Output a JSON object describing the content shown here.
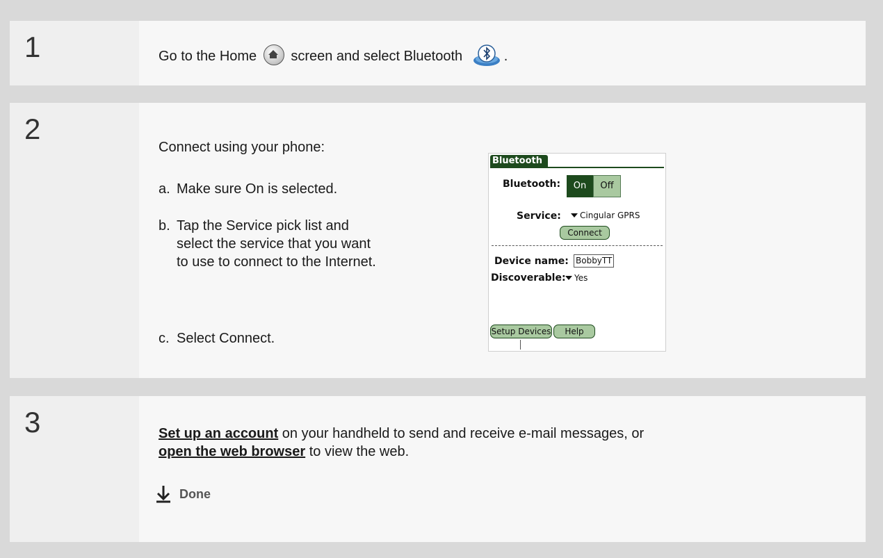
{
  "step1": {
    "number": "1",
    "text_before": "Go to the Home",
    "text_middle": "screen and select Bluetooth",
    "text_end": ".",
    "home_icon": "home-icon",
    "bluetooth_icon": "bluetooth-icon"
  },
  "step2": {
    "number": "2",
    "intro": "Connect using your phone:",
    "a_letter": "a.",
    "a_text": "Make sure On is selected.",
    "b_letter": "b.",
    "b_text": "Tap the Service pick list and select the service that you want to use to connect to the Internet.",
    "c_letter": "c.",
    "c_text": "Select Connect.",
    "device": {
      "tab_title": "Bluetooth",
      "bluetooth_label": "Bluetooth:",
      "on_label": "On",
      "off_label": "Off",
      "selected": "On",
      "service_label": "Service:",
      "service_value": "Cingular GPRS",
      "connect_label": "Connect",
      "device_name_label": "Device name:",
      "device_name_value": "BobbyTT",
      "discoverable_label": "Discoverable:",
      "discoverable_value": "Yes",
      "setup_devices_label": "Setup Devices",
      "help_label": "Help"
    }
  },
  "step3": {
    "number": "3",
    "link1": "Set up an account",
    "text1": " on your handheld to send and receive e-mail messages, or",
    "link2": "open the web browser",
    "text2": " to view the web.",
    "done_label": "Done",
    "done_icon": "arrow-down-icon"
  },
  "colors": {
    "page_background": "#d9d9d9",
    "number_column": "#efefef",
    "content_background": "#f7f7f7",
    "palm_green_dark": "#1d4a1d",
    "palm_green_light": "#a9c9a0"
  }
}
